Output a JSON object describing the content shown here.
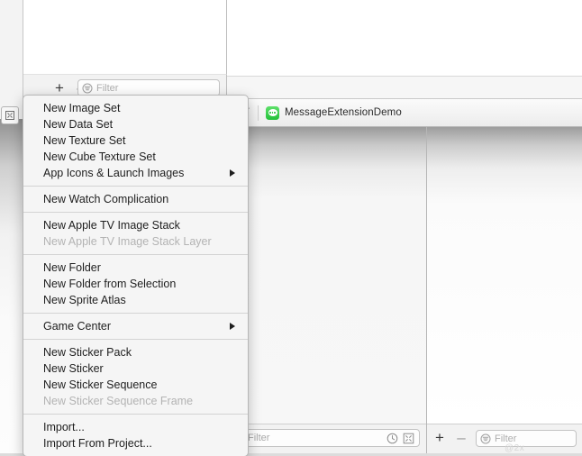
{
  "window": {
    "background_color": "#ffffff",
    "chrome_color": "#f2f2f2"
  },
  "navigator": {
    "toolbar": {
      "add_label": "+",
      "remove_label": "–",
      "filter": {
        "value": "",
        "placeholder": "Filter",
        "icon": "filter-circle-icon"
      }
    }
  },
  "gutter": {
    "icon": "inspector-toggle-icon"
  },
  "jump_bar": {
    "back_icon": "navigate-arrow-icon",
    "project_icon": "messages-app-icon",
    "project_name": "MessageExtensionDemo"
  },
  "bottom_left_bar": {
    "filter": {
      "value": "",
      "placeholder": "Filter",
      "icon": "filter-circle-icon"
    },
    "history_icon": "clock-icon",
    "resize_icon": "fit-icon"
  },
  "bottom_right_bar": {
    "add_label": "+",
    "remove_label": "–",
    "filter": {
      "value": "",
      "placeholder": "Filter",
      "icon": "filter-circle-icon"
    },
    "ghost_text": "@2x"
  },
  "context_menu": {
    "groups": [
      {
        "items": [
          {
            "label": "New Image Set",
            "disabled": false,
            "submenu": false
          },
          {
            "label": "New Data Set",
            "disabled": false,
            "submenu": false
          },
          {
            "label": "New Texture Set",
            "disabled": false,
            "submenu": false
          },
          {
            "label": "New Cube Texture Set",
            "disabled": false,
            "submenu": false
          },
          {
            "label": "App Icons & Launch Images",
            "disabled": false,
            "submenu": true
          }
        ]
      },
      {
        "items": [
          {
            "label": "New Watch Complication",
            "disabled": false,
            "submenu": false
          }
        ]
      },
      {
        "items": [
          {
            "label": "New Apple TV Image Stack",
            "disabled": false,
            "submenu": false
          },
          {
            "label": "New Apple TV Image Stack Layer",
            "disabled": true,
            "submenu": false
          }
        ]
      },
      {
        "items": [
          {
            "label": "New Folder",
            "disabled": false,
            "submenu": false
          },
          {
            "label": "New Folder from Selection",
            "disabled": false,
            "submenu": false
          },
          {
            "label": "New Sprite Atlas",
            "disabled": false,
            "submenu": false
          }
        ]
      },
      {
        "items": [
          {
            "label": "Game Center",
            "disabled": false,
            "submenu": true
          }
        ]
      },
      {
        "items": [
          {
            "label": "New Sticker Pack",
            "disabled": false,
            "submenu": false
          },
          {
            "label": "New Sticker",
            "disabled": false,
            "submenu": false
          },
          {
            "label": "New Sticker Sequence",
            "disabled": false,
            "submenu": false
          },
          {
            "label": "New Sticker Sequence Frame",
            "disabled": true,
            "submenu": false
          }
        ]
      },
      {
        "items": [
          {
            "label": "Import...",
            "disabled": false,
            "submenu": false
          },
          {
            "label": "Import From Project...",
            "disabled": false,
            "submenu": false
          }
        ]
      }
    ]
  }
}
